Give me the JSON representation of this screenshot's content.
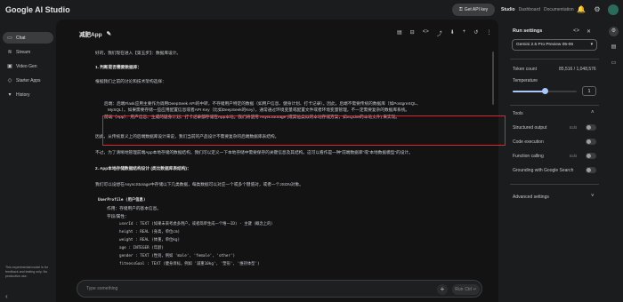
{
  "app": {
    "title": "Google AI Studio"
  },
  "topbar": {
    "get_api_key": "Get API key",
    "nav": [
      "Studio",
      "Dashboard",
      "Documentation"
    ],
    "icons": [
      "bell-icon",
      "settings-icon"
    ]
  },
  "sidebar": {
    "items": [
      {
        "label": "Chat",
        "icon": "chat-icon"
      },
      {
        "label": "Stream",
        "icon": "stream-icon"
      },
      {
        "label": "Video Gen",
        "icon": "video-icon"
      },
      {
        "label": "Starter Apps",
        "icon": "apps-icon"
      },
      {
        "label": "History",
        "icon": "history-icon"
      }
    ],
    "footer": "This experimental model is for feedback and testing only. No production use."
  },
  "chat": {
    "title": "减肥App",
    "lines": [
      "好的，我们现在进入【第五步】：数据库设计。",
      "1. 判断是否需要数据库：",
      "根据我们之前的讨论和技术架构选择：",
      "后端：后端Flask应用主要作为调用DeepSeek API的中转，不存储用户特定的数据（如用户信息、健身计划、打卡记录）。因此，后端不需要传统的数据库（如PostgreSQL、",
      "MySQL）。如果需要存储一些应用配置信息或者API Key（比如DeepSeek的Key），通常通过环境变量或配置文件或者环境变量管理，不一定需要复杂的数据库系统。",
      "前端（App）：用户信息、生成的健身计划、打卡记录都存储在App本地。我们将使用 AsyncStorage (或其他类似的本地存储方案，如SQLite的本地文件) 来实现。",
      "因此，从传统意义上的后端数据库设计来说，我们当前的产品设计不需要复杂的后端数据库表结构。",
      "不过，为了清晰地管理前端App本地存储的数据结构，我们可以定义一下本地存储中需要保存的关键信息及其结构。这可以看作是一种“前端数据库”或“本地数据模型”的设计。",
      "2. App本地存储数据结构设计 (类比数据库表结构)：",
      "我们可以设想在AsyncStorage中存储以下几类数据，每类数据可以对应一个或多个键值对，或者一个JSON对象。",
      "UserProfile (用户信息)",
      "作用：存储用户的基本信息。",
      "字段/属性：",
      "userId : TEXT (如果未来考虑多用户，或者简单生成一个唯一ID) - 主键（概念上的）",
      "height : REAL (身高，单位cm)",
      "weight : REAL (体重，单位kg)",
      "age : INTEGER (年龄)",
      "gender : TEXT (性别，例如 'male', 'female', 'other')",
      "fitnessGoal : TEXT (健身目标，例如 '减重10kg', '塑形', '维持体型')"
    ],
    "placeholder": "Type something",
    "run_label": "Run",
    "run_shortcut": "Ctrl ↵"
  },
  "run_settings": {
    "title": "Run settings",
    "model": "Gemini 2.5 Pro Preview 05-06",
    "token_count_label": "Token count",
    "token_count_value": "85,516 / 1,048,576",
    "temperature_label": "Temperature",
    "temperature_value": "1",
    "temperature_fraction": 0.5,
    "tools_label": "Tools",
    "tools": [
      {
        "label": "Structured output",
        "edit": "Edit"
      },
      {
        "label": "Code execution",
        "edit": ""
      },
      {
        "label": "Function calling",
        "edit": "Edit"
      },
      {
        "label": "Grounding with Google Search",
        "edit": ""
      }
    ],
    "advanced_label": "Advanced settings"
  }
}
